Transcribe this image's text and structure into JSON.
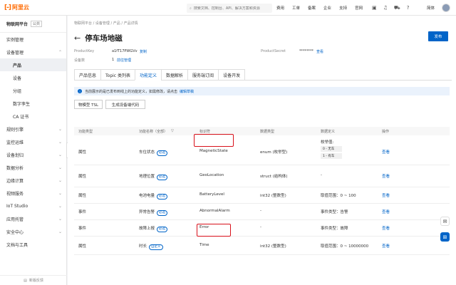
{
  "topbar": {
    "logo_text": "阿里云",
    "search_placeholder": "搜索文档、控制台、API、解决方案和资源",
    "nav": [
      "费用",
      "工单",
      "备案",
      "企业",
      "支持",
      "官网"
    ],
    "lang": "简体"
  },
  "sidebar": {
    "platform": "物联网平台",
    "platform_tag": "公共",
    "items": [
      {
        "label": "实例管理",
        "sub": false,
        "active": false,
        "arrow": ""
      },
      {
        "label": "设备管理",
        "sub": false,
        "active": false,
        "arrow": "⌃"
      },
      {
        "label": "产品",
        "sub": true,
        "active": true,
        "arrow": ""
      },
      {
        "label": "设备",
        "sub": true,
        "active": false,
        "arrow": ""
      },
      {
        "label": "分组",
        "sub": true,
        "active": false,
        "arrow": ""
      },
      {
        "label": "数字孪生",
        "sub": true,
        "active": false,
        "arrow": ""
      },
      {
        "label": "CA 证书",
        "sub": true,
        "active": false,
        "arrow": ""
      },
      {
        "label": "规则引擎",
        "sub": false,
        "active": false,
        "arrow": "⌄"
      },
      {
        "label": "监控运维",
        "sub": false,
        "active": false,
        "arrow": "⌄"
      },
      {
        "label": "设备划归",
        "sub": false,
        "active": false,
        "arrow": "⌄"
      },
      {
        "label": "数据分析",
        "sub": false,
        "active": false,
        "arrow": "⌄"
      },
      {
        "label": "边缘计算",
        "sub": false,
        "active": false,
        "arrow": "⌄"
      },
      {
        "label": "视频服务",
        "sub": false,
        "active": false,
        "arrow": "⌄"
      },
      {
        "label": "IoT Studio",
        "sub": false,
        "active": false,
        "arrow": "⌄"
      },
      {
        "label": "应用托管",
        "sub": false,
        "active": false,
        "arrow": "⌄"
      },
      {
        "label": "安全中心",
        "sub": false,
        "active": false,
        "arrow": "⌄"
      },
      {
        "label": "文档与工具",
        "sub": false,
        "active": false,
        "arrow": ""
      }
    ],
    "footer": "新版反馈"
  },
  "main": {
    "breadcrumb": "物联网平台  /  设备管理  /  产品  /  产品详情",
    "title": "停车场地磁",
    "publish": "发布",
    "product_key_label": "ProductKey",
    "product_key_value": "a1fT17PWGVv",
    "copy": "复制",
    "product_secret_label": "ProductSecret",
    "product_secret_value": "********",
    "view": "查看",
    "device_count_label": "设备数",
    "device_count_value": "1",
    "goto_manage": "前往管理",
    "tabs": [
      "产品信息",
      "Topic 类列表",
      "功能定义",
      "数据解析",
      "服务端订阅",
      "设备开发"
    ],
    "notice": "当前展示的是已发布到线上的功能定义，如需修改，请点击",
    "notice_link": "编辑草稿",
    "btn_tsl": "物模型 TSL",
    "btn_gen": "生成设备端代码",
    "table": {
      "headers": [
        "功能类型",
        "功能名称（全部）",
        "标识符",
        "数据类型",
        "数据定义",
        "操作"
      ],
      "rows": [
        {
          "type": "属性",
          "name": "车位状态",
          "badge": "必选",
          "id": "MagneticState",
          "dtype": "enum (枚举型)",
          "def": "枚举值:",
          "enums": [
            "0 - 无车",
            "1 - 有车"
          ],
          "op": "查看"
        },
        {
          "type": "属性",
          "name": "地理位置",
          "badge": "必选",
          "id": "GeoLocation",
          "dtype": "struct (结构体)",
          "def": "-",
          "enums": [],
          "op": "查看"
        },
        {
          "type": "属性",
          "name": "电池电量",
          "badge": "必选",
          "id": "BatteryLevel",
          "dtype": "int32 (整数型)",
          "def": "取值范围：0 ~ 100",
          "enums": [],
          "op": "查看"
        },
        {
          "type": "事件",
          "name": "异常告警",
          "badge": "必选",
          "id": "AbnormalAlarm",
          "dtype": "-",
          "def": "事件类型：告警",
          "enums": [],
          "op": "查看"
        },
        {
          "type": "事件",
          "name": "故障上报",
          "badge": "必选",
          "id": "Error",
          "dtype": "-",
          "def": "事件类型：故障",
          "enums": [],
          "op": "查看"
        },
        {
          "type": "属性",
          "name": "时长",
          "badge": "自定义",
          "id": "Time",
          "dtype": "int32 (整数型)",
          "def": "取值范围：0 ~ 10000000",
          "enums": [],
          "op": "查看"
        }
      ]
    }
  }
}
